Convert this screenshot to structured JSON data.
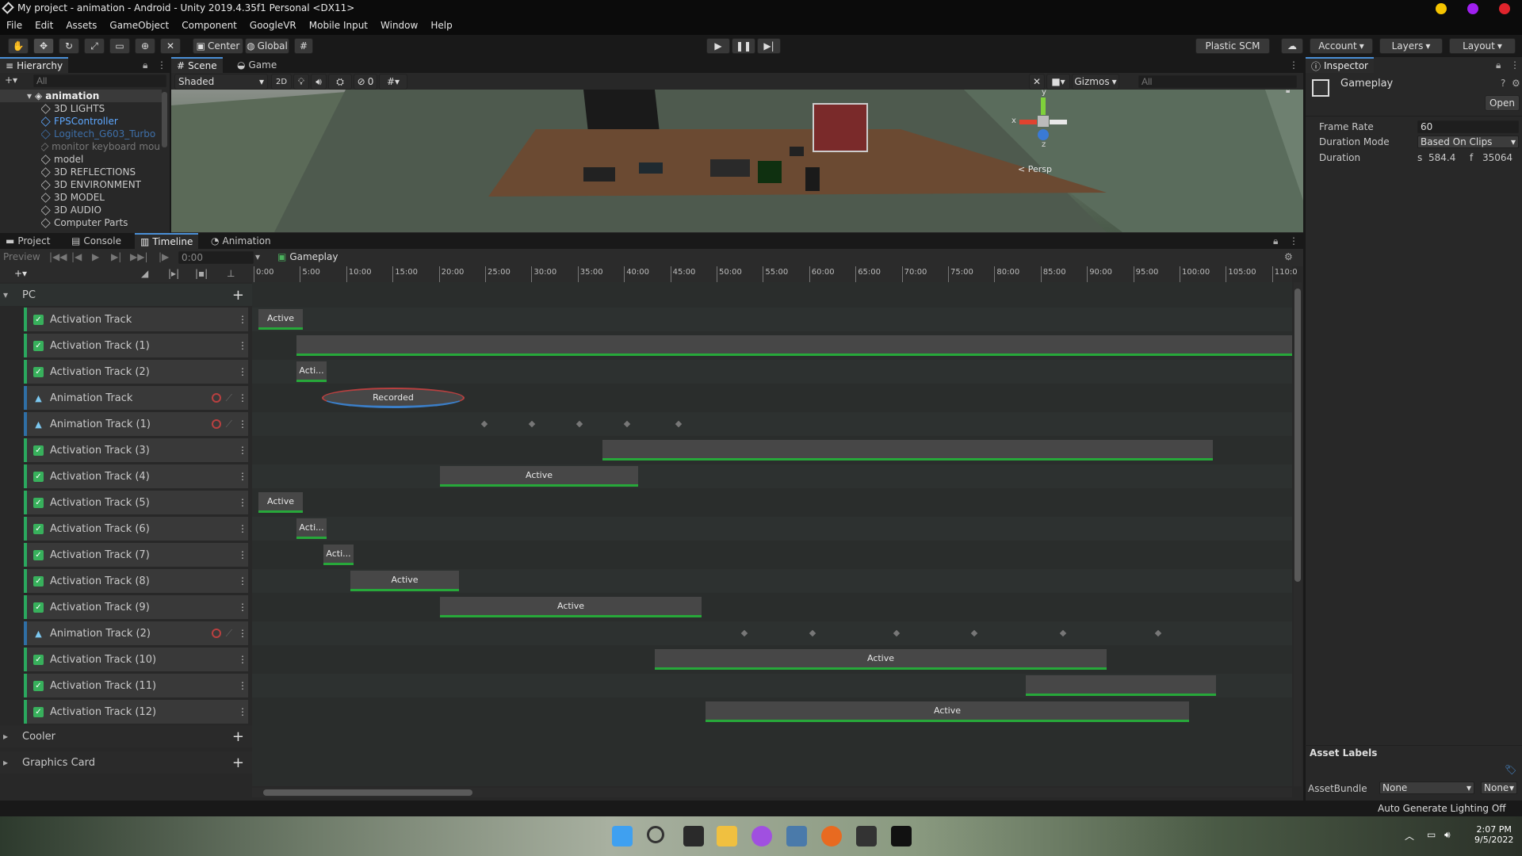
{
  "window": {
    "title": "My project - animation - Android - Unity 2019.4.35f1 Personal <DX11>"
  },
  "menu": [
    "File",
    "Edit",
    "Assets",
    "GameObject",
    "Component",
    "GoogleVR",
    "Mobile Input",
    "Window",
    "Help"
  ],
  "toolbar": {
    "center": "Center",
    "global": "Global",
    "plastic": "Plastic SCM",
    "account": "Account",
    "layers": "Layers",
    "layout": "Layout"
  },
  "hierarchy": {
    "tab": "Hierarchy",
    "search_placeholder": "All",
    "root": "animation",
    "items": [
      "3D LIGHTS",
      "FPSController",
      "Logitech_G603_Turbo",
      "monitor keyboard mou",
      "model",
      "3D REFLECTIONS",
      "3D ENVIRONMENT",
      "3D MODEL",
      "3D AUDIO",
      "Computer Parts"
    ]
  },
  "scene": {
    "tab_scene": "Scene",
    "tab_game": "Game",
    "shading": "Shaded",
    "mode2d": "2D",
    "hidden_count": "0",
    "gizmos": "Gizmos",
    "search_placeholder": "All",
    "persp": "< Persp",
    "axis_x": "x",
    "axis_y": "y",
    "axis_z": "z"
  },
  "bottom_tabs": {
    "project": "Project",
    "console": "Console",
    "timeline": "Timeline",
    "animation": "Animation"
  },
  "timeline": {
    "preview": "Preview",
    "time": "0:00",
    "asset": "Gameplay",
    "ticks": [
      "0:00",
      "5:00",
      "10:00",
      "15:00",
      "20:00",
      "25:00",
      "30:00",
      "35:00",
      "40:00",
      "45:00",
      "50:00",
      "55:00",
      "60:00",
      "65:00",
      "70:00",
      "75:00",
      "80:00",
      "85:00",
      "90:00",
      "95:00",
      "100:00",
      "105:00",
      "110:0"
    ],
    "groups": [
      "PC",
      "Cooler",
      "Graphics Card"
    ],
    "tracks": [
      {
        "name": "Activation Track",
        "type": "activation",
        "clip": "Active"
      },
      {
        "name": "Activation Track (1)",
        "type": "activation",
        "clip": ""
      },
      {
        "name": "Activation Track (2)",
        "type": "activation",
        "clip": "Acti..."
      },
      {
        "name": "Animation Track",
        "type": "animation",
        "clip": "Recorded"
      },
      {
        "name": "Animation Track (1)",
        "type": "animation",
        "clip": ""
      },
      {
        "name": "Activation Track (3)",
        "type": "activation",
        "clip": ""
      },
      {
        "name": "Activation Track (4)",
        "type": "activation",
        "clip": "Active"
      },
      {
        "name": "Activation Track (5)",
        "type": "activation",
        "clip": "Active"
      },
      {
        "name": "Activation Track (6)",
        "type": "activation",
        "clip": "Acti..."
      },
      {
        "name": "Activation Track (7)",
        "type": "activation",
        "clip": "Acti..."
      },
      {
        "name": "Activation Track (8)",
        "type": "activation",
        "clip": "Active"
      },
      {
        "name": "Activation Track (9)",
        "type": "activation",
        "clip": "Active"
      },
      {
        "name": "Animation Track (2)",
        "type": "animation",
        "clip": ""
      },
      {
        "name": "Activation Track (10)",
        "type": "activation",
        "clip": "Active"
      },
      {
        "name": "Activation Track (11)",
        "type": "activation",
        "clip": ""
      },
      {
        "name": "Activation Track (12)",
        "type": "activation",
        "clip": "Active"
      }
    ]
  },
  "inspector": {
    "tab": "Inspector",
    "asset": "Gameplay",
    "open": "Open",
    "frame_rate_label": "Frame Rate",
    "frame_rate": "60",
    "duration_mode_label": "Duration Mode",
    "duration_mode": "Based On Clips",
    "duration_label": "Duration",
    "duration_s_label": "s",
    "duration_s": "584.4",
    "duration_f_label": "f",
    "duration_f": "35064",
    "asset_labels": "Asset Labels",
    "assetbundle_label": "AssetBundle",
    "assetbundle": "None",
    "variant": "None"
  },
  "status": {
    "lighting": "Auto Generate Lighting Off"
  },
  "taskbar": {
    "time": "2:07 PM",
    "date": "9/5/2022"
  },
  "colors": {
    "activation_green": "#38b05c",
    "clip_line_green": "#27a83a",
    "animation_blue": "#3b7ec7",
    "accent": "#4a8fd6"
  }
}
